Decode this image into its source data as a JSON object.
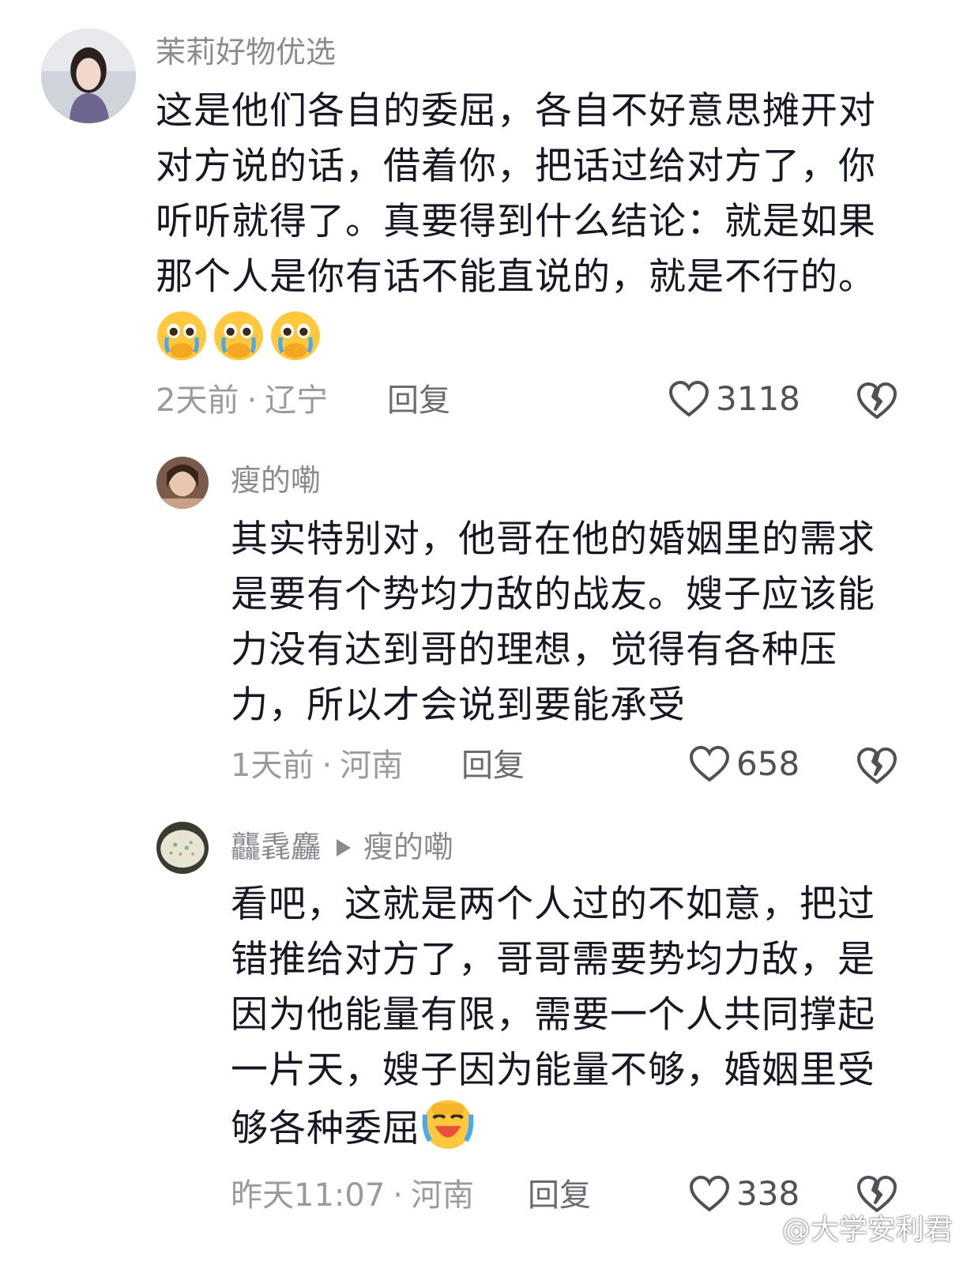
{
  "comments": [
    {
      "username": "茉莉好物优选",
      "text": "这是他们各自的委屈，各自不好意思摊开对对方说的话，借着你，把话过给对方了，你听听就得了。真要得到什么结论：就是如果那个人是你有话不能直说的，就是不行的。",
      "time": "2天前",
      "location": "辽宁",
      "reply_label": "回复",
      "likes": "3118",
      "emojis": [
        "crying-face-emoji",
        "crying-face-emoji",
        "crying-face-emoji"
      ]
    },
    {
      "username": "瘦的嘞",
      "text": "其实特别对，他哥在他的婚姻里的需求是要有个势均力敌的战友。嫂子应该能力没有达到哥的理想，觉得有各种压力，所以才会说到要能承受",
      "time": "1天前",
      "location": "河南",
      "reply_label": "回复",
      "likes": "658"
    },
    {
      "username": "龘毳麤",
      "reply_to": "瘦的嘞",
      "text": "看吧，这就是两个人过的不如意，把过错推给对方了，哥哥需要势均力敌，是因为他能量有限，需要一个人共同撑起一片天，嫂子因为能量不够，婚姻里受够各种委屈",
      "time": "昨天11:07",
      "location": "河南",
      "reply_label": "回复",
      "likes": "338",
      "emojis": [
        "laughing-crying-emoji"
      ]
    }
  ],
  "watermark": "@大学安利君",
  "colors": {
    "text": "#161823",
    "username": "#8a8b91",
    "meta": "#9a9ba0"
  }
}
